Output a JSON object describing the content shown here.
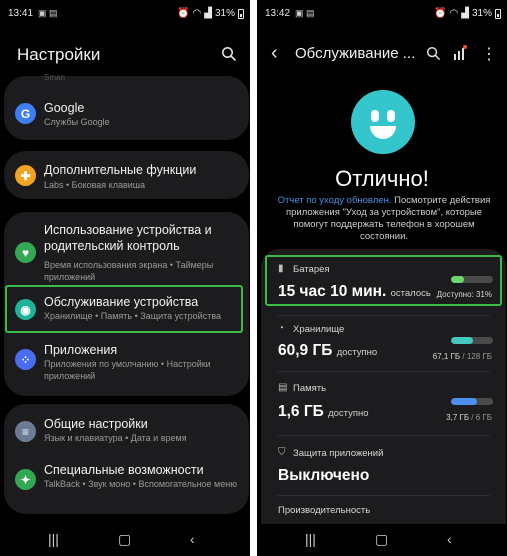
{
  "left_screen": {
    "status": {
      "time": "13:41",
      "battery": "31%"
    },
    "title": "Настройки",
    "top_partial": "Sman",
    "items": [
      {
        "title": "Google",
        "subtitle": "Службы Google",
        "icon": "google-icon",
        "color": "#3d7ef2"
      },
      {
        "title": "Дополнительные функции",
        "subtitle": "Labs  •  Боковая клавиша",
        "icon": "puzzle-icon",
        "color": "#f0a422"
      },
      {
        "title": "Использование устройства и родительский контроль",
        "subtitle": "Время использования экрана  •  Таймеры приложений",
        "icon": "wellbeing-icon",
        "color": "#35a853"
      },
      {
        "title": "Обслуживание устройства",
        "subtitle": "Хранилище  •  Память  •  Защита устройства",
        "icon": "device-care-icon",
        "color": "#1fb29b"
      },
      {
        "title": "Приложения",
        "subtitle": "Приложения по умолчанию  •  Настройки приложений",
        "icon": "apps-icon",
        "color": "#4a6cf0"
      },
      {
        "title": "Общие настройки",
        "subtitle": "Язык и клавиатура  •  Дата и время",
        "icon": "sliders-icon",
        "color": "#6a7d95"
      },
      {
        "title": "Специальные возможности",
        "subtitle": "TalkBack  •  Звук моно  •  Вспомогательное меню",
        "icon": "accessibility-icon",
        "color": "#32a852"
      }
    ]
  },
  "right_screen": {
    "status": {
      "time": "13:42",
      "battery": "31%"
    },
    "title": "Обслуживание ...",
    "status_text": "Отлично!",
    "description": {
      "link": "Отчет по уходу обновлен.",
      "text": " Посмотрите действия приложения \"Уход за устройством\", которые помогут поддержать телефон в хорошем состоянии."
    },
    "battery": {
      "label": "Батарея",
      "value": "15 час 10 мин.",
      "suffix": "осталось",
      "detail": "Доступно: 31%",
      "level": 0.31,
      "color": "#6fd66f"
    },
    "storage": {
      "label": "Хранилище",
      "value": "60,9 ГБ",
      "suffix": "доступно",
      "used": "67,1 ГБ",
      "total": " / 128 ГБ",
      "level": 0.52,
      "color": "#44c7c1"
    },
    "memory": {
      "label": "Память",
      "value": "1,6 ГБ",
      "suffix": "доступно",
      "used": "3,7 ГБ",
      "total": " / 6 ГБ",
      "level": 0.62,
      "color": "#4d8ff0"
    },
    "protection": {
      "label": "Защита приложений",
      "value": "Выключено"
    },
    "performance_label": "Производительность"
  }
}
